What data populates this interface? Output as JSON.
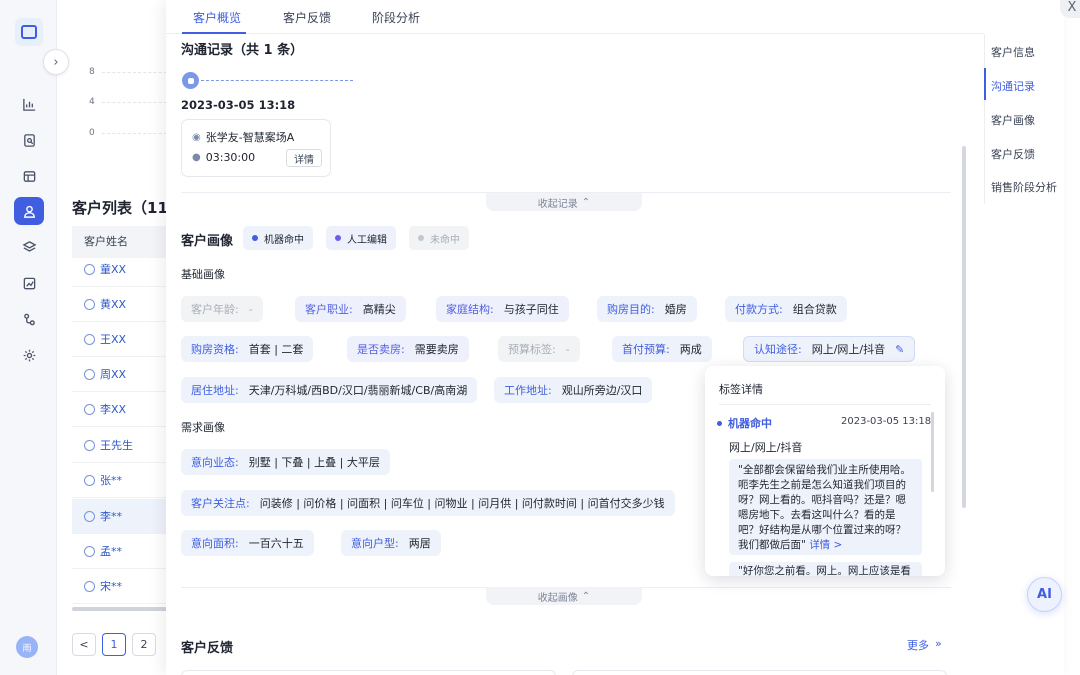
{
  "rail": {
    "avatar_text": "雨",
    "icons": [
      "chart-icon",
      "report-icon",
      "box-icon",
      "customer-icon",
      "layers-icon",
      "analysis-icon",
      "flow-icon",
      "settings-icon"
    ]
  },
  "background": {
    "y_ticks": [
      "8",
      "4",
      "0"
    ],
    "list_title": "客户列表（11",
    "column_header": "客户姓名",
    "rows": [
      "童XX",
      "黄XX",
      "王XX",
      "周XX",
      "李XX",
      "王先生",
      "张**",
      "李**",
      "孟**",
      "宋**"
    ],
    "selected_row": "李**",
    "pages": [
      "1",
      "2"
    ],
    "prev": "<"
  },
  "drawer": {
    "tabs": [
      "客户概览",
      "客户反馈",
      "阶段分析"
    ],
    "active_tab": "客户概览",
    "close": "X",
    "communication": {
      "title": "沟通记录（共 1 条）",
      "time": "2023-03-05 13:18",
      "agent": "张学友-智慧案场A",
      "duration": "03:30:00",
      "detail_button": "详情",
      "collapse": "收起记录"
    },
    "portrait": {
      "title": "客户画像",
      "legend": [
        {
          "label": "机器命中",
          "color": "#3f5ee0"
        },
        {
          "label": "人工编辑",
          "color": "#6a5ee6"
        },
        {
          "label": "未命中",
          "color": "#c2c6cf"
        }
      ],
      "basic_title": "基础画像",
      "needs_title": "需求画像",
      "tags": {
        "age": {
          "k": "客户年龄:",
          "v": "-"
        },
        "job": {
          "k": "客户职业:",
          "v": "高精尖"
        },
        "family": {
          "k": "家庭结构:",
          "v": "与孩子同住"
        },
        "purpose": {
          "k": "购房目的:",
          "v": "婚房"
        },
        "payment": {
          "k": "付款方式:",
          "v": "组合贷款"
        },
        "qualification": {
          "k": "购房资格:",
          "v": "首套 | 二套"
        },
        "selling": {
          "k": "是否卖房:",
          "v": "需要卖房"
        },
        "budget_tag": {
          "k": "预算标签:",
          "v": "-"
        },
        "down_payment": {
          "k": "首付预算:",
          "v": "两成"
        },
        "channel": {
          "k": "认知途径:",
          "v": "网上/网上/抖音"
        },
        "residence": {
          "k": "居住地址:",
          "v": "天津/万科城/西BD/汉口/翡丽新城/CB/高南湖"
        },
        "work": {
          "k": "工作地址:",
          "v": "观山所旁边/汉口"
        },
        "property_type": {
          "k": "意向业态:",
          "v": "别墅 | 下叠 | 上叠 | 大平层"
        },
        "concerns": {
          "k": "客户关注点:",
          "v": "问装修 | 问价格 | 问面积 | 问车位 | 问物业 | 问月供 | 问付款时间 | 问首付交多少钱"
        },
        "area": {
          "k": "意向面积:",
          "v": "一百六十五"
        },
        "layout": {
          "k": "意向户型:",
          "v": "两居"
        }
      },
      "collapse": "收起画像"
    },
    "feedback": {
      "title": "客户反馈",
      "more": "更多",
      "more_icon": "»"
    }
  },
  "right_nav": {
    "items": [
      "客户信息",
      "沟通记录",
      "客户画像",
      "客户反馈",
      "销售阶段分析"
    ],
    "active": "沟通记录"
  },
  "popover": {
    "title": "标签详情",
    "source": "机器命中",
    "timestamp": "2023-03-05 13:18",
    "value": "网上/网上/抖音",
    "quote": "\"全部都会保留给我们业主所使用哈。呃李先生之前是怎么知道我们项目的呀？网上看的。呃抖音吗？还是？嗯嗯房地下。去看这叫什么？看的是吧？好结构是从哪个位置过来的呀？我们都做后面\"",
    "quote_link": "详情 >",
    "quote2": "\"好你您之前看。网上。网上应该是看"
  },
  "ai_button": "AI"
}
